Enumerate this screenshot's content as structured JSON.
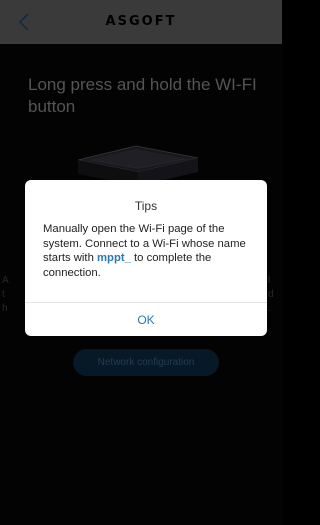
{
  "header": {
    "brand_logo_text": "ASGOFT",
    "back_icon": "chevron-left-icon",
    "background_color": "#6a6a6a"
  },
  "main": {
    "instruction": "Long press and hold the WI-FI button",
    "device_image": "inverter-device-illustration",
    "network_button_label": "Network configuration",
    "network_button_color": "#0d2c48"
  },
  "dialog": {
    "title": "Tips",
    "message_part1": "Manually open the Wi-Fi page of the system. Connect to a Wi-Fi whose name starts with ",
    "message_highlight": "mppt_",
    "message_part2": " to complete the connection.",
    "ok_label": "OK",
    "accent_color": "#2b78b5"
  }
}
